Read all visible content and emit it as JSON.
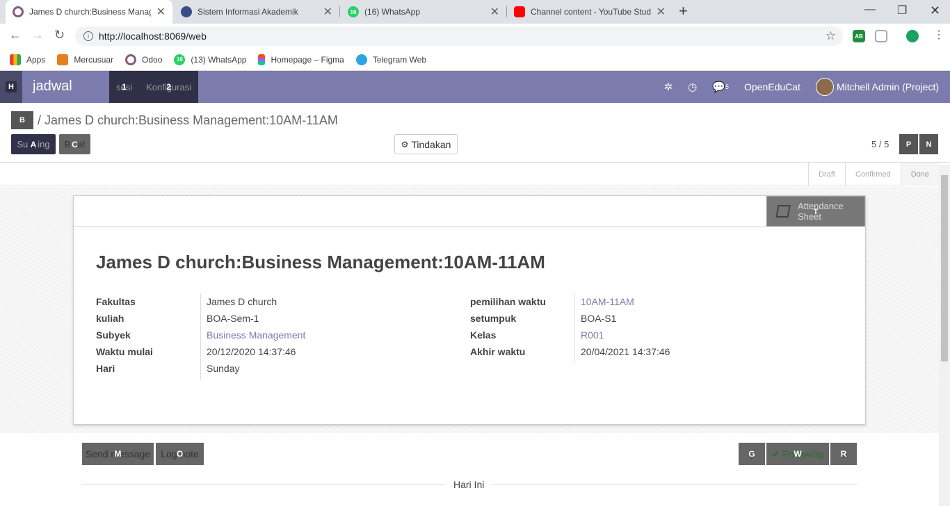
{
  "browser": {
    "tabs": [
      {
        "title": "James D church:Business Manage",
        "icon": "odoo-icon",
        "color": "#875a7b",
        "active": true
      },
      {
        "title": "Sistem Informasi Akademik",
        "icon": "academic-icon",
        "color": "#3b4b8a",
        "active": false
      },
      {
        "title": "(16) WhatsApp",
        "icon": "whatsapp-icon",
        "color": "#25d366",
        "badge": "16",
        "active": false
      },
      {
        "title": "Channel content - YouTube Studi",
        "icon": "youtube-icon",
        "color": "#ff0000",
        "active": false
      }
    ],
    "url": "http://localhost:8069/web",
    "bookmarks": [
      {
        "label": "Apps",
        "icon": "apps-grid-icon"
      },
      {
        "label": "Mercusuar",
        "icon": "mercusuar-icon"
      },
      {
        "label": "Odoo",
        "icon": "odoo-icon"
      },
      {
        "label": "(13) WhatsApp",
        "icon": "whatsapp-icon",
        "badge": "16"
      },
      {
        "label": "Homepage – Figma",
        "icon": "figma-icon"
      },
      {
        "label": "Telegram Web",
        "icon": "telegram-icon"
      }
    ],
    "extensions": {
      "adblock": "AB"
    }
  },
  "navbar": {
    "home_hint": "H",
    "app_title": "jadwal",
    "menus": [
      {
        "label": "sesi",
        "hint": "1"
      },
      {
        "label": "Konfigurasi",
        "hint": "2"
      }
    ],
    "messages_count": "5",
    "company": "OpenEduCat",
    "user": "Mitchell Admin (Project)"
  },
  "control": {
    "breadcrumb_parent": "sesi",
    "breadcrumb_hint": "B",
    "breadcrumb_current": "/ James D church:Business Management:10AM-11AM",
    "save_label": "Simpan",
    "save_hint": "A",
    "save_display": "Su",
    "save_display2": "ing",
    "discard_label": "Buang",
    "discard_hint": "C",
    "discard_display1": "B",
    "discard_display2": "at",
    "action_label": "Tindakan",
    "pager": "5 / 5",
    "prev_hint": "P",
    "next_hint": "N"
  },
  "stages": [
    {
      "label": "Draft",
      "current": false
    },
    {
      "label": "Confirmed",
      "current": false
    },
    {
      "label": "Done",
      "current": true
    }
  ],
  "sheet": {
    "attendance_label": "Attendance Sheet",
    "attendance_line1": "Attendance",
    "attendance_line2": "Sheet",
    "attendance_hint": "T",
    "title": "James D church:Business Management:10AM-11AM",
    "left_fields": [
      {
        "label": "Fakultas",
        "value": "James D church",
        "link": false
      },
      {
        "label": "kuliah",
        "value": "BOA-Sem-1",
        "link": false
      },
      {
        "label": "Subyek",
        "value": "Business Management",
        "link": true
      },
      {
        "label": "Waktu mulai",
        "value": "20/12/2020 14:37:46",
        "link": false
      },
      {
        "label": "Hari",
        "value": "Sunday",
        "link": false
      }
    ],
    "right_fields": [
      {
        "label": "pemilihan waktu",
        "value": "10AM-11AM",
        "link": true
      },
      {
        "label": "setumpuk",
        "value": "BOA-S1",
        "link": false
      },
      {
        "label": "Kelas",
        "value": "R001",
        "link": true
      },
      {
        "label": "Akhir waktu",
        "value": "20/04/2021 14:37:46",
        "link": false
      }
    ]
  },
  "chatter": {
    "send_message": "Send message",
    "send_hint": "M",
    "log_note": "Log note",
    "log_hint": "O",
    "attach_hint": "G",
    "following": "Following",
    "following_hint": "W",
    "followers_hint": "R",
    "today": "Hari Ini"
  }
}
